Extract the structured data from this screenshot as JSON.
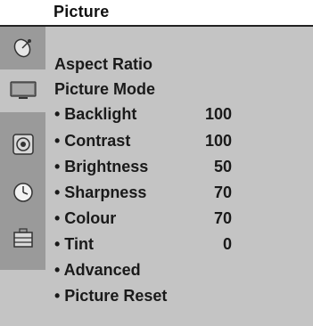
{
  "menu": {
    "title": "Picture"
  },
  "sidebar": {
    "tabs": [
      {
        "name": "satellite-dish-icon"
      },
      {
        "name": "tv-screen-icon"
      },
      {
        "name": "speaker-icon"
      },
      {
        "name": "clock-icon"
      },
      {
        "name": "lock-icon"
      }
    ]
  },
  "items": [
    {
      "label": "Aspect Ratio",
      "value": ""
    },
    {
      "label": "Picture Mode",
      "value": ""
    },
    {
      "label": "• Backlight",
      "value": "100"
    },
    {
      "label": "• Contrast",
      "value": "100"
    },
    {
      "label": "• Brightness",
      "value": "50"
    },
    {
      "label": "• Sharpness",
      "value": "70"
    },
    {
      "label": "• Colour",
      "value": "70"
    },
    {
      "label": "• Tint",
      "value": "0"
    },
    {
      "label": "• Advanced",
      "value": ""
    },
    {
      "label": "• Picture Reset",
      "value": ""
    }
  ]
}
